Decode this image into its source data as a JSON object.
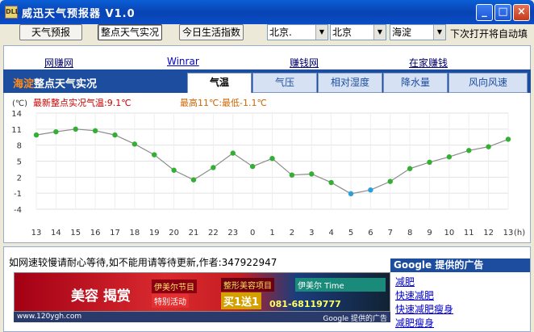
{
  "window": {
    "icon_text": "DLL",
    "title": "威迅天气预报器 V1.0",
    "min_glyph": "_",
    "max_glyph": "□",
    "close_glyph": "×"
  },
  "toolbar": {
    "forecast_btn": "天气预报",
    "hourly_btn": "整点天气实况",
    "life_btn": "今日生活指数",
    "province": "北京.",
    "city": "北京",
    "district": "海淀",
    "auto_open_label": "下次打开将自动填"
  },
  "links": [
    "网赚网",
    "Winrar",
    "赚钱网",
    "在家赚钱"
  ],
  "header": {
    "location": "海淀",
    "title": "整点天气实况"
  },
  "tabs": [
    "气温",
    "气压",
    "相对湿度",
    "降水量",
    "风向风速"
  ],
  "active_tab": 0,
  "chart_data": {
    "type": "line",
    "unit_label": "(℃)",
    "hour_unit": "(h)",
    "current_label": "最新整点实况气温:9.1℃",
    "range_label": "最高11℃:最低-1.1℃",
    "x": [
      "13",
      "14",
      "15",
      "16",
      "17",
      "18",
      "19",
      "20",
      "21",
      "22",
      "23",
      "0",
      "1",
      "2",
      "3",
      "4",
      "5",
      "6",
      "7",
      "8",
      "9",
      "10",
      "11",
      "12",
      "13"
    ],
    "values": [
      9.9,
      10.5,
      11.0,
      10.7,
      9.9,
      8.2,
      6.2,
      3.3,
      1.5,
      3.8,
      6.5,
      4.0,
      5.5,
      2.4,
      2.6,
      1.0,
      -1.1,
      -0.4,
      1.2,
      3.6,
      4.8,
      5.8,
      7.0,
      7.7,
      9.1
    ],
    "highlight_indices": [
      16,
      17
    ],
    "yticks": [
      14,
      11,
      8,
      5,
      2,
      -1,
      -4
    ],
    "ylim": [
      -4,
      14
    ],
    "line_color": "#8c8c8c",
    "point_color": "#33b033",
    "highlight_color": "#2a9fd8",
    "current_color": "#cc0000",
    "range_color": "#cc6600"
  },
  "notice": "如网速较慢请耐心等待,如不能用请等待更新,作者:347922947",
  "ad": {
    "main_text": "美容 揭赏",
    "tag1": "伊美尔节目",
    "tag2": "特别活动",
    "tag3": "整形美容项目",
    "tag4": "买1送1",
    "tag5": "伊美尔 Time",
    "phone": "081-68119777",
    "site": "www.120ygh.com",
    "provider": "Google 提供的广告"
  },
  "google_ads": {
    "heading": "Google 提供的广告",
    "items": [
      "减肥",
      "快速减肥",
      "快速减肥瘦身",
      "减肥瘦身"
    ]
  }
}
